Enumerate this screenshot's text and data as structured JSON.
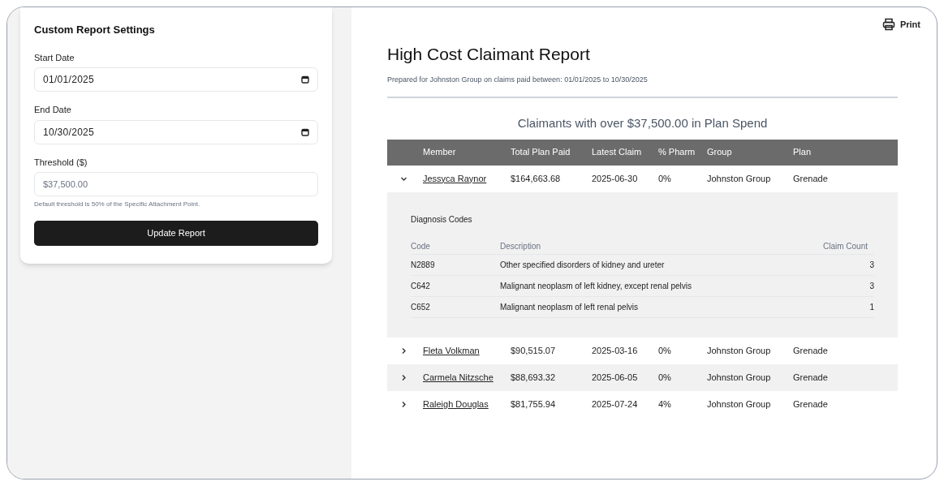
{
  "settings": {
    "title": "Custom Report Settings",
    "fields": [
      {
        "kind": "date",
        "label": "Start Date",
        "value": "01/01/2025"
      },
      {
        "kind": "date",
        "label": "End Date",
        "value": "10/30/2025"
      },
      {
        "kind": "text",
        "label": "Threshold ($)",
        "placeholder": "$37,500.00",
        "hint": "Default threshold is 50% of the Specific Attachment Point."
      }
    ],
    "button": "Update Report"
  },
  "print_label": "Print",
  "report": {
    "title": "High Cost Claimant Report",
    "subtitle": "Prepared for Johnston Group on claims paid between: 01/01/2025 to 10/30/2025",
    "table_title": "Claimants with over $37,500.00 in Plan Spend",
    "columns": [
      "Member",
      "Total Plan Paid",
      "Latest Claim",
      "% Pharm",
      "Group",
      "Plan"
    ],
    "rows": [
      {
        "expanded": true,
        "cells": [
          "Jessyca Raynor",
          "$164,663.68",
          "2025-06-30",
          "0%",
          "Johnston Group",
          "Grenade"
        ],
        "details": {
          "title": "Diagnosis Codes",
          "columns": [
            "Code",
            "Description",
            "Claim Count"
          ],
          "rows": [
            [
              "N2889",
              "Other specified disorders of kidney and ureter",
              "3"
            ],
            [
              "C642",
              "Malignant neoplasm of left kidney, except renal pelvis",
              "3"
            ],
            [
              "C652",
              "Malignant neoplasm of left renal pelvis",
              "1"
            ]
          ]
        }
      },
      {
        "expanded": false,
        "cells": [
          "Fleta Volkman",
          "$90,515.07",
          "2025-03-16",
          "0%",
          "Johnston Group",
          "Grenade"
        ]
      },
      {
        "expanded": false,
        "cells": [
          "Carmela Nitzsche",
          "$88,693.32",
          "2025-06-05",
          "0%",
          "Johnston Group",
          "Grenade"
        ]
      },
      {
        "expanded": false,
        "cells": [
          "Raleigh Douglas",
          "$81,755.94",
          "2025-07-24",
          "4%",
          "Johnston Group",
          "Grenade"
        ]
      }
    ]
  }
}
